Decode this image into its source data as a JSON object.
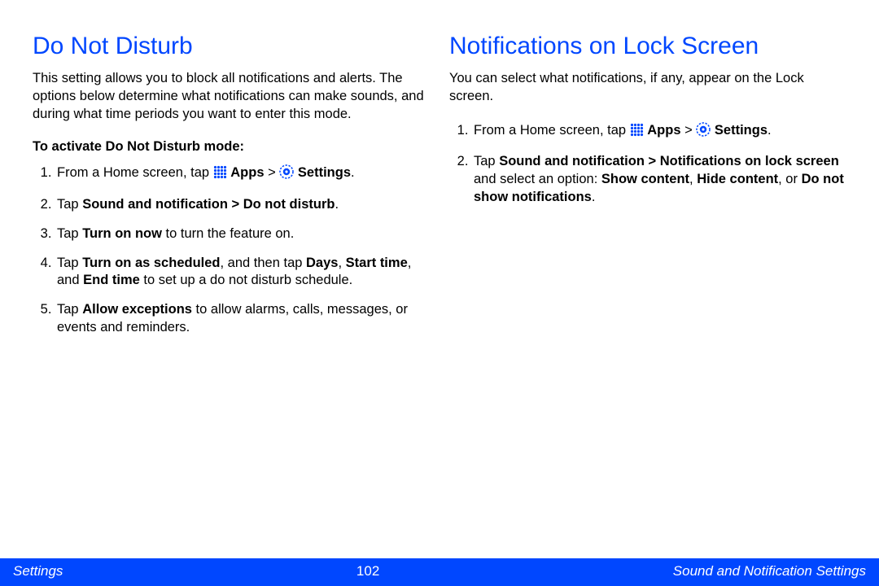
{
  "left": {
    "heading": "Do Not Disturb",
    "intro": "This setting allows you to block all notifications and alerts. The options below determine what notifications can make sounds, and during what time periods you want to enter this mode.",
    "sub": "To activate Do Not Disturb mode:",
    "step1_prefix": "From a Home screen, tap ",
    "apps_label": "Apps",
    "gt": " > ",
    "settings_label": "Settings",
    "period": ".",
    "step2_a": "Tap ",
    "step2_b": "Sound and notification > Do not disturb",
    "step3_a": "Tap ",
    "step3_b": "Turn on now",
    "step3_c": " to turn the feature on.",
    "step4_a": "Tap ",
    "step4_b": "Turn on as scheduled",
    "step4_c": ", and then tap ",
    "step4_d": "Days",
    "step4_e": ", ",
    "step4_f": "Start time",
    "step4_g": ", and ",
    "step4_h": "End time",
    "step4_i": " to set up a do not disturb schedule.",
    "step5_a": "Tap ",
    "step5_b": "Allow exceptions",
    "step5_c": " to allow alarms, calls, messages, or events and reminders."
  },
  "right": {
    "heading": "Notifications on Lock Screen",
    "intro": "You can select what notifications, if any, appear on the Lock screen.",
    "step1_prefix": "From a Home screen, tap ",
    "apps_label": "Apps",
    "gt": " > ",
    "settings_label": "Settings",
    "period": ".",
    "step2_a": "Tap ",
    "step2_b": "Sound and notification > Notifications on lock screen",
    "step2_c": " and select an option: ",
    "step2_d": "Show content",
    "step2_e": ", ",
    "step2_f": "Hide content",
    "step2_g": ", or ",
    "step2_h": "Do not show notifications",
    "step2_i": "."
  },
  "footer": {
    "left": "Settings",
    "center": "102",
    "right": "Sound and Notification Settings"
  }
}
